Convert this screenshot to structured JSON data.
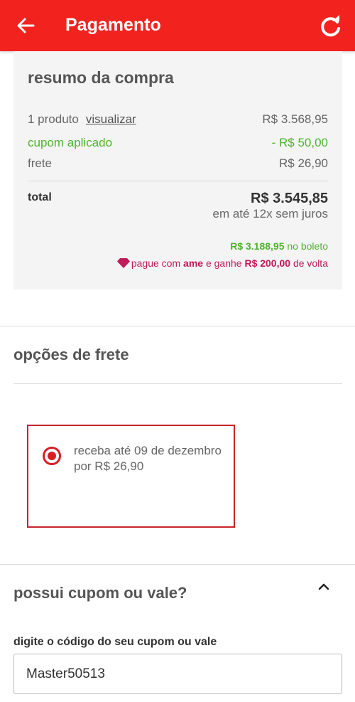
{
  "header": {
    "title": "Pagamento"
  },
  "summary": {
    "heading": "resumo da compra",
    "products_label": "1 produto",
    "view_link": "visualizar",
    "products_value": "R$ 3.568,95",
    "coupon_label": "cupom aplicado",
    "coupon_value": "- R$ 50,00",
    "shipping_label": "frete",
    "shipping_value": "R$ 26,90",
    "total_label": "total",
    "total_value": "R$ 3.545,85",
    "installments": "em até 12x sem juros",
    "boleto_value": "R$ 3.188,95",
    "boleto_text": "no boleto",
    "ame_prefix": "pague com",
    "ame_brand": "ame",
    "ame_mid": "e ganhe",
    "ame_cashback": "R$ 200,00",
    "ame_suffix": "de volta"
  },
  "shipping": {
    "title": "opções de frete",
    "option_text": "receba até 09 de dezembro por R$ 26,90",
    "selected": true
  },
  "coupon": {
    "title": "possui cupom ou vale?",
    "field_label": "digite o código do seu cupom ou vale",
    "field_value": "Master50513"
  },
  "colors": {
    "brand_red": "#f2231f",
    "green": "#4db32d",
    "ame_pink": "#c01a5a"
  }
}
